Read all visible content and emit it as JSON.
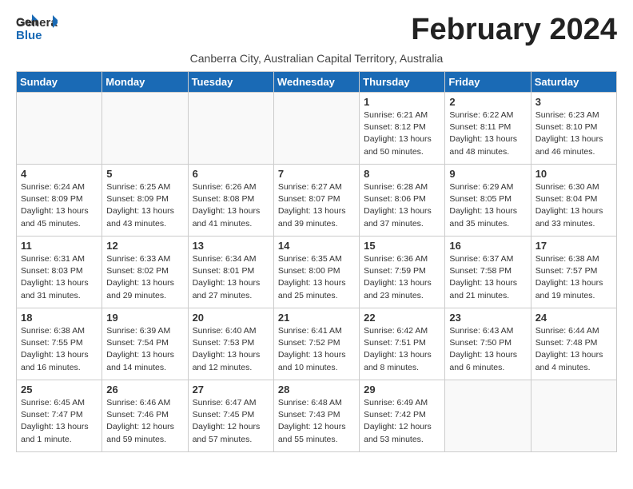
{
  "header": {
    "logo_general": "General",
    "logo_blue": "Blue",
    "month": "February 2024",
    "subtitle": "Canberra City, Australian Capital Territory, Australia"
  },
  "weekdays": [
    "Sunday",
    "Monday",
    "Tuesday",
    "Wednesday",
    "Thursday",
    "Friday",
    "Saturday"
  ],
  "weeks": [
    [
      {
        "day": "",
        "info": ""
      },
      {
        "day": "",
        "info": ""
      },
      {
        "day": "",
        "info": ""
      },
      {
        "day": "",
        "info": ""
      },
      {
        "day": "1",
        "info": "Sunrise: 6:21 AM\nSunset: 8:12 PM\nDaylight: 13 hours\nand 50 minutes."
      },
      {
        "day": "2",
        "info": "Sunrise: 6:22 AM\nSunset: 8:11 PM\nDaylight: 13 hours\nand 48 minutes."
      },
      {
        "day": "3",
        "info": "Sunrise: 6:23 AM\nSunset: 8:10 PM\nDaylight: 13 hours\nand 46 minutes."
      }
    ],
    [
      {
        "day": "4",
        "info": "Sunrise: 6:24 AM\nSunset: 8:09 PM\nDaylight: 13 hours\nand 45 minutes."
      },
      {
        "day": "5",
        "info": "Sunrise: 6:25 AM\nSunset: 8:09 PM\nDaylight: 13 hours\nand 43 minutes."
      },
      {
        "day": "6",
        "info": "Sunrise: 6:26 AM\nSunset: 8:08 PM\nDaylight: 13 hours\nand 41 minutes."
      },
      {
        "day": "7",
        "info": "Sunrise: 6:27 AM\nSunset: 8:07 PM\nDaylight: 13 hours\nand 39 minutes."
      },
      {
        "day": "8",
        "info": "Sunrise: 6:28 AM\nSunset: 8:06 PM\nDaylight: 13 hours\nand 37 minutes."
      },
      {
        "day": "9",
        "info": "Sunrise: 6:29 AM\nSunset: 8:05 PM\nDaylight: 13 hours\nand 35 minutes."
      },
      {
        "day": "10",
        "info": "Sunrise: 6:30 AM\nSunset: 8:04 PM\nDaylight: 13 hours\nand 33 minutes."
      }
    ],
    [
      {
        "day": "11",
        "info": "Sunrise: 6:31 AM\nSunset: 8:03 PM\nDaylight: 13 hours\nand 31 minutes."
      },
      {
        "day": "12",
        "info": "Sunrise: 6:33 AM\nSunset: 8:02 PM\nDaylight: 13 hours\nand 29 minutes."
      },
      {
        "day": "13",
        "info": "Sunrise: 6:34 AM\nSunset: 8:01 PM\nDaylight: 13 hours\nand 27 minutes."
      },
      {
        "day": "14",
        "info": "Sunrise: 6:35 AM\nSunset: 8:00 PM\nDaylight: 13 hours\nand 25 minutes."
      },
      {
        "day": "15",
        "info": "Sunrise: 6:36 AM\nSunset: 7:59 PM\nDaylight: 13 hours\nand 23 minutes."
      },
      {
        "day": "16",
        "info": "Sunrise: 6:37 AM\nSunset: 7:58 PM\nDaylight: 13 hours\nand 21 minutes."
      },
      {
        "day": "17",
        "info": "Sunrise: 6:38 AM\nSunset: 7:57 PM\nDaylight: 13 hours\nand 19 minutes."
      }
    ],
    [
      {
        "day": "18",
        "info": "Sunrise: 6:38 AM\nSunset: 7:55 PM\nDaylight: 13 hours\nand 16 minutes."
      },
      {
        "day": "19",
        "info": "Sunrise: 6:39 AM\nSunset: 7:54 PM\nDaylight: 13 hours\nand 14 minutes."
      },
      {
        "day": "20",
        "info": "Sunrise: 6:40 AM\nSunset: 7:53 PM\nDaylight: 13 hours\nand 12 minutes."
      },
      {
        "day": "21",
        "info": "Sunrise: 6:41 AM\nSunset: 7:52 PM\nDaylight: 13 hours\nand 10 minutes."
      },
      {
        "day": "22",
        "info": "Sunrise: 6:42 AM\nSunset: 7:51 PM\nDaylight: 13 hours\nand 8 minutes."
      },
      {
        "day": "23",
        "info": "Sunrise: 6:43 AM\nSunset: 7:50 PM\nDaylight: 13 hours\nand 6 minutes."
      },
      {
        "day": "24",
        "info": "Sunrise: 6:44 AM\nSunset: 7:48 PM\nDaylight: 13 hours\nand 4 minutes."
      }
    ],
    [
      {
        "day": "25",
        "info": "Sunrise: 6:45 AM\nSunset: 7:47 PM\nDaylight: 13 hours\nand 1 minute."
      },
      {
        "day": "26",
        "info": "Sunrise: 6:46 AM\nSunset: 7:46 PM\nDaylight: 12 hours\nand 59 minutes."
      },
      {
        "day": "27",
        "info": "Sunrise: 6:47 AM\nSunset: 7:45 PM\nDaylight: 12 hours\nand 57 minutes."
      },
      {
        "day": "28",
        "info": "Sunrise: 6:48 AM\nSunset: 7:43 PM\nDaylight: 12 hours\nand 55 minutes."
      },
      {
        "day": "29",
        "info": "Sunrise: 6:49 AM\nSunset: 7:42 PM\nDaylight: 12 hours\nand 53 minutes."
      },
      {
        "day": "",
        "info": ""
      },
      {
        "day": "",
        "info": ""
      }
    ]
  ]
}
